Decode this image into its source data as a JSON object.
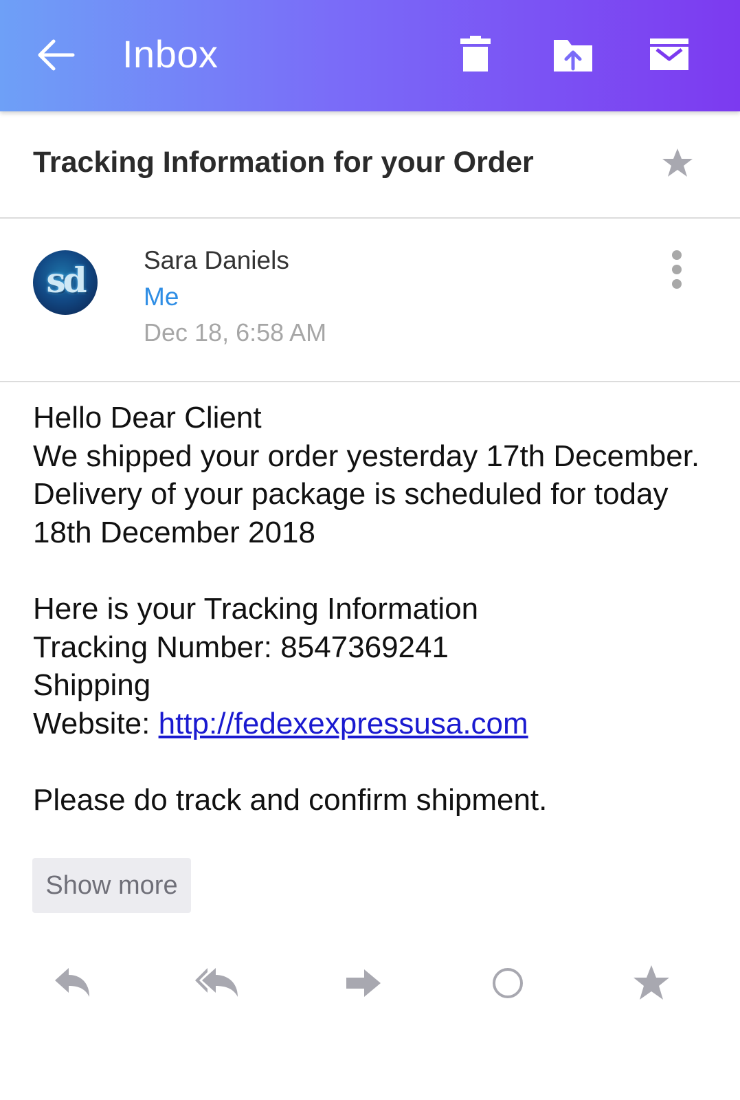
{
  "appbar": {
    "title": "Inbox",
    "back_icon": "arrow-left-icon",
    "actions": [
      {
        "name": "delete",
        "icon": "trash-icon"
      },
      {
        "name": "move",
        "icon": "folder-move-icon"
      },
      {
        "name": "archive",
        "icon": "archive-icon"
      }
    ],
    "gradient": [
      "#6ea0f7",
      "#7a6cf8",
      "#7c3af0"
    ]
  },
  "email": {
    "subject": "Tracking Information for your Order",
    "starred": false,
    "sender": "Sara Daniels",
    "avatar_text": "sd",
    "recipient": "Me",
    "date": "Dec 18, 6:58 AM",
    "body": {
      "line1": "Hello Dear Client",
      "line2": "We shipped your order yesterday 17th December.",
      "line3": "Delivery of your package is scheduled for today 18th December 2018",
      "line4": "Here is your Tracking Information",
      "line5": "Tracking Number: 8547369241",
      "line6": "Shipping",
      "website_label": "Website: ",
      "website_link": "http://fedexexpressusa.com",
      "line8": "Please do track and confirm shipment."
    },
    "show_more_label": "Show more"
  },
  "bottom_actions": [
    {
      "name": "reply",
      "icon": "reply-icon"
    },
    {
      "name": "reply-all",
      "icon": "reply-all-icon"
    },
    {
      "name": "forward",
      "icon": "forward-icon"
    },
    {
      "name": "mark-unread",
      "icon": "circle-icon"
    },
    {
      "name": "star",
      "icon": "star-icon"
    }
  ],
  "colors": {
    "accent_link": "#2f8ee5",
    "hyperlink": "#1a1ad0",
    "icon_gray": "#a8a8b0"
  }
}
